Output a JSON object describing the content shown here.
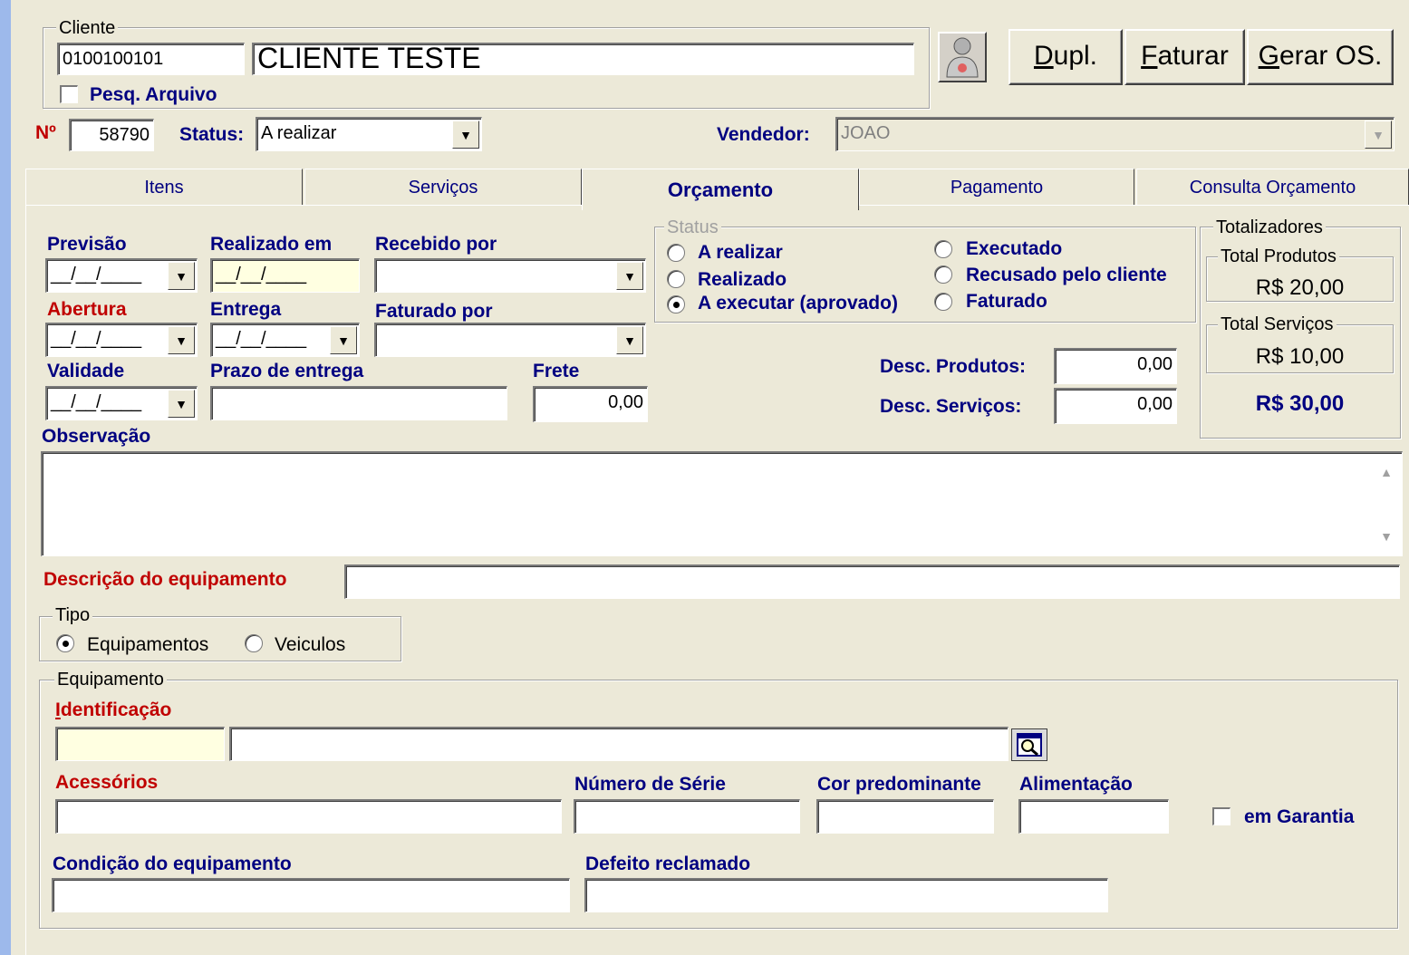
{
  "cliente": {
    "group_label": "Cliente",
    "code": "0100100101",
    "name": "CLIENTE TESTE",
    "pesq_arquivo_label": "Pesq. Arquivo"
  },
  "buttons": {
    "dupl": "upl.",
    "dupl_mnemonic": "D",
    "faturar": "aturar",
    "faturar_mnemonic": "F",
    "gerar_os": "erar OS.",
    "gerar_os_mnemonic": "G"
  },
  "header": {
    "numero_label": "Nº",
    "numero_value": "58790",
    "status_label": "Status:",
    "status_value": "A realizar",
    "vendedor_label": "Vendedor:",
    "vendedor_value": "JOAO"
  },
  "tabs": [
    {
      "label": "Itens"
    },
    {
      "label": "Serviços"
    },
    {
      "label": "Orçamento"
    },
    {
      "label": "Pagamento"
    },
    {
      "label": "Consulta Orçamento"
    }
  ],
  "orcamento": {
    "previsao_label": "Previsão",
    "previsao_value": "__/__/____",
    "realizado_em_label": "Realizado em",
    "realizado_em_value": "__/__/____",
    "recebido_por_label": "Recebido por",
    "abertura_label": "Abertura",
    "abertura_value": "__/__/____",
    "entrega_label": "Entrega",
    "entrega_value": "__/__/____",
    "faturado_por_label": "Faturado por",
    "validade_label": "Validade",
    "validade_value": "__/__/____",
    "prazo_label": "Prazo de entrega",
    "frete_label": "Frete",
    "frete_value": "0,00",
    "observacao_label": "Observação"
  },
  "status_group": {
    "label": "Status",
    "options": [
      "A realizar",
      "Realizado",
      "A executar (aprovado)",
      "Executado",
      "Recusado pelo cliente",
      "Faturado"
    ],
    "selected": "A executar (aprovado)"
  },
  "descontos": {
    "produtos_label": "Desc. Produtos:",
    "produtos_value": "0,00",
    "servicos_label": "Desc. Serviços:",
    "servicos_value": "0,00"
  },
  "totalizadores": {
    "label": "Totalizadores",
    "produtos_label": "Total  Produtos",
    "produtos_value": "R$ 20,00",
    "servicos_label": "Total Serviços",
    "servicos_value": "R$ 10,00",
    "total_value": "R$ 30,00"
  },
  "equipamento_desc": {
    "label": "Descrição do equipamento",
    "value": ""
  },
  "tipo": {
    "label": "Tipo",
    "options": [
      "Equipamentos",
      "Veiculos"
    ],
    "selected": "Equipamentos"
  },
  "equipamento": {
    "group_label": "Equipamento",
    "identificacao_label": "dentificação",
    "identificacao_mnemonic": "I",
    "acessorios_label": "Acessórios",
    "numero_serie_label": "Número de Série",
    "cor_label": "Cor predominante",
    "alimentacao_label": "Alimentação",
    "garantia_label": "em Garantia",
    "condicao_label": "Condição do equipamento",
    "defeito_label": "Defeito reclamado"
  }
}
